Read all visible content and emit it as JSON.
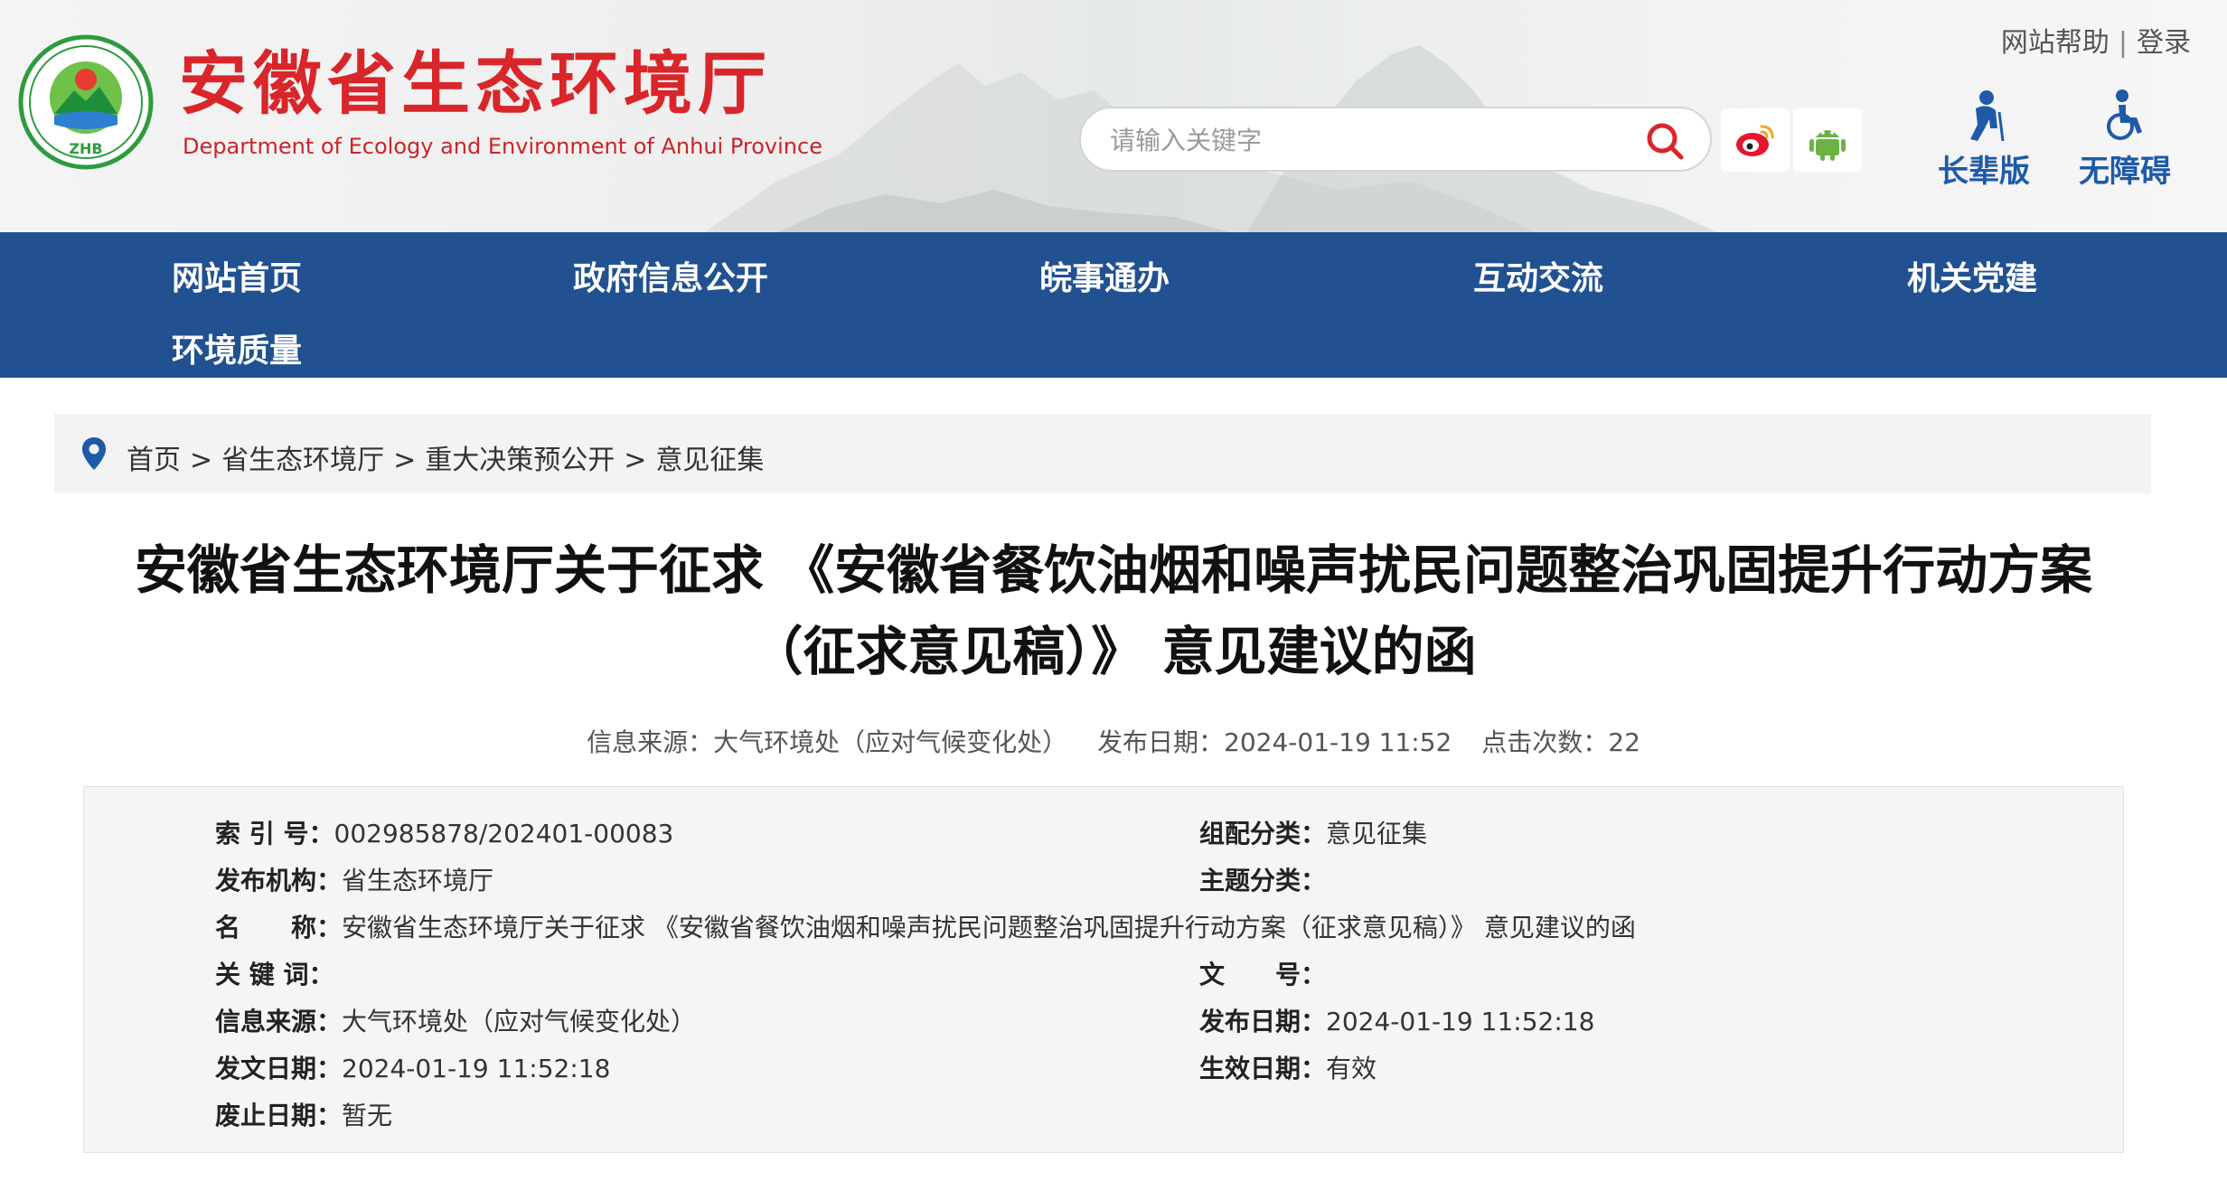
{
  "header": {
    "logo_emblem_text": "ZHB",
    "logo_cn": "安徽省生态环境厅",
    "logo_en": "Department of Ecology and Environment of Anhui Province",
    "top_links": [
      "网站帮助",
      "登录"
    ],
    "search_placeholder": "请输入关键字",
    "accessibility": {
      "elder": "长辈版",
      "barrier_free": "无障碍"
    }
  },
  "nav": {
    "items": [
      "网站首页",
      "政府信息公开",
      "皖事通办",
      "互动交流",
      "机关党建",
      "环境质量"
    ]
  },
  "breadcrumb": [
    "首页",
    "省生态环境厅",
    "重大决策预公开",
    "意见征集"
  ],
  "breadcrumb_sep": ">",
  "article": {
    "title_line1": "安徽省生态环境厅关于征求 《安徽省餐饮油烟和噪声扰民问题整治巩固提升行动方案",
    "title_line2": "（征求意见稿）》 意见建议的函",
    "meta": {
      "source_label": "信息来源：",
      "source": "大气环境处（应对气候变化处）",
      "date_label": "发布日期：",
      "date": "2024-01-19 11:52",
      "views_label": "点击次数：",
      "views": "22"
    }
  },
  "info_table": {
    "index_no": {
      "label": "索 引 号：",
      "value": "002985878/202401-00083"
    },
    "category": {
      "label": "组配分类：",
      "value": "意见征集"
    },
    "publisher": {
      "label": "发布机构：",
      "value": "省生态环境厅"
    },
    "topic": {
      "label": "主题分类：",
      "value": ""
    },
    "name": {
      "label": "名　　称：",
      "value": "安徽省生态环境厅关于征求 《安徽省餐饮油烟和噪声扰民问题整治巩固提升行动方案（征求意见稿）》 意见建议的函"
    },
    "keywords": {
      "label": "关 键 词：",
      "value": ""
    },
    "doc_no": {
      "label": "文　　号：",
      "value": ""
    },
    "info_source": {
      "label": "信息来源：",
      "value": "大气环境处（应对气候变化处）"
    },
    "publish_date": {
      "label": "发布日期：",
      "value": "2024-01-19 11:52:18"
    },
    "issue_date": {
      "label": "发文日期：",
      "value": "2024-01-19 11:52:18"
    },
    "effective": {
      "label": "生效日期：",
      "value": "有效"
    },
    "repeal_date": {
      "label": "废止日期：",
      "value": "暂无"
    }
  },
  "colors": {
    "nav_bg": "#215191",
    "brand_red": "#d8262a",
    "accent_blue": "#1e5aa8",
    "logo_green": "#2e9b3e"
  },
  "icons": [
    "search-icon",
    "weibo-icon",
    "android-icon",
    "elder-icon",
    "wheelchair-icon",
    "location-pin-icon"
  ]
}
